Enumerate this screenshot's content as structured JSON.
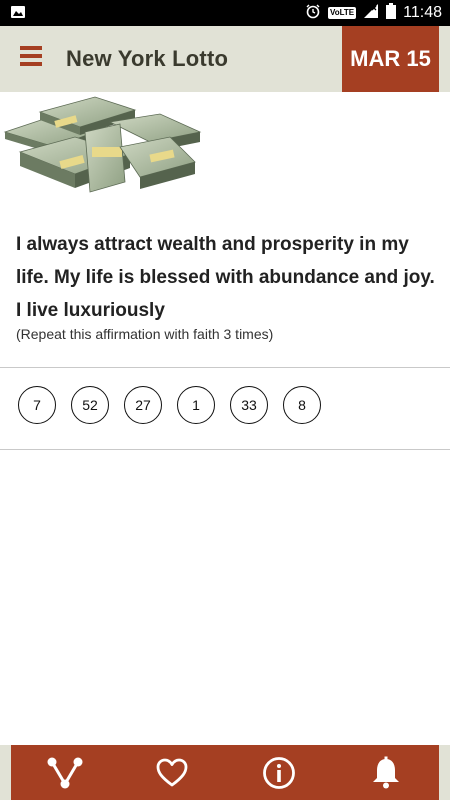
{
  "status_bar": {
    "time": "11:48",
    "network_badge": "VoLTE"
  },
  "app_bar": {
    "title": "New York Lotto",
    "date": "MAR 15"
  },
  "affirmation": {
    "text": "I always attract wealth and prosperity in my life. My life is blessed with abundance and joy. I live luxuriously",
    "note": "(Repeat this affirmation with faith 3 times)"
  },
  "numbers": [
    "7",
    "52",
    "27",
    "1",
    "33",
    "8"
  ],
  "colors": {
    "accent": "#a53f22",
    "bar_bg": "#e1e2d6",
    "title": "#3a3a2e"
  },
  "bottom_nav": {
    "icons": [
      "share-icon",
      "heart-icon",
      "info-icon",
      "bell-icon"
    ]
  }
}
